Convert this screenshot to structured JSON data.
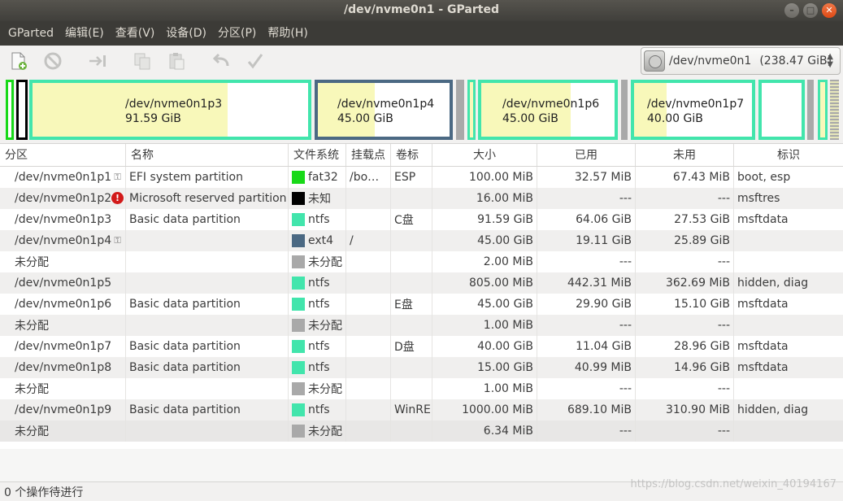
{
  "window": {
    "title": "/dev/nvme0n1 - GParted"
  },
  "menu": [
    "GParted",
    "编辑(E)",
    "查看(V)",
    "设备(D)",
    "分区(P)",
    "帮助(H)"
  ],
  "toolbar": {
    "icons": [
      "new-partition-icon",
      "delete-icon",
      "resize-move-icon",
      "copy-icon",
      "paste-icon",
      "undo-icon",
      "apply-icon"
    ]
  },
  "device_selector": {
    "device": "/dev/nvme0n1",
    "size": "(238.47 GiB)",
    "icon": "disk-icon"
  },
  "map": {
    "labels": [
      {
        "name": "/dev/nvme0n1p3",
        "size": "91.59 GiB"
      },
      {
        "name": "/dev/nvme0n1p4",
        "size": "45.00 GiB"
      },
      {
        "name": "/dev/nvme0n1p6",
        "size": "45.00 GiB"
      },
      {
        "name": "/dev/nvme0n1p7",
        "size": "40.00 GiB"
      }
    ]
  },
  "colors": {
    "ntfs": "#42e5ac",
    "fat32": "#18d918",
    "unknown": "#000000",
    "ext4": "#4b6983",
    "unallocated": "#a9a9a9",
    "used_fill": "#f8f8ba",
    "free_fill": "#ffffff"
  },
  "table": {
    "headers": [
      "分区",
      "名称",
      "文件系统",
      "挂载点",
      "卷标",
      "大小",
      "已用",
      "未用",
      "标识"
    ],
    "rows": [
      {
        "partition": "/dev/nvme0n1p1",
        "icon": "key-icon",
        "name": "EFI system partition",
        "fs": "fat32",
        "fs_color": "#18d918",
        "mount": "/bo…",
        "label": "ESP",
        "size": "100.00 MiB",
        "used": "32.57 MiB",
        "unused": "67.43 MiB",
        "flags": "boot, esp"
      },
      {
        "partition": "/dev/nvme0n1p2",
        "icon": "warning-icon",
        "name": "Microsoft reserved partition",
        "fs": "未知",
        "fs_color": "#000000",
        "mount": "",
        "label": "",
        "size": "16.00 MiB",
        "used": "---",
        "unused": "---",
        "flags": "msftres"
      },
      {
        "partition": "/dev/nvme0n1p3",
        "icon": "",
        "name": "Basic data partition",
        "fs": "ntfs",
        "fs_color": "#42e5ac",
        "mount": "",
        "label": "C盘",
        "size": "91.59 GiB",
        "used": "64.06 GiB",
        "unused": "27.53 GiB",
        "flags": "msftdata"
      },
      {
        "partition": "/dev/nvme0n1p4",
        "icon": "key-icon",
        "name": "",
        "fs": "ext4",
        "fs_color": "#4b6983",
        "mount": "/",
        "label": "",
        "size": "45.00 GiB",
        "used": "19.11 GiB",
        "unused": "25.89 GiB",
        "flags": ""
      },
      {
        "partition": "未分配",
        "icon": "",
        "name": "",
        "fs": "未分配",
        "fs_color": "#a9a9a9",
        "mount": "",
        "label": "",
        "size": "2.00 MiB",
        "used": "---",
        "unused": "---",
        "flags": ""
      },
      {
        "partition": "/dev/nvme0n1p5",
        "icon": "",
        "name": "",
        "fs": "ntfs",
        "fs_color": "#42e5ac",
        "mount": "",
        "label": "",
        "size": "805.00 MiB",
        "used": "442.31 MiB",
        "unused": "362.69 MiB",
        "flags": "hidden, diag"
      },
      {
        "partition": "/dev/nvme0n1p6",
        "icon": "",
        "name": "Basic data partition",
        "fs": "ntfs",
        "fs_color": "#42e5ac",
        "mount": "",
        "label": "E盘",
        "size": "45.00 GiB",
        "used": "29.90 GiB",
        "unused": "15.10 GiB",
        "flags": "msftdata"
      },
      {
        "partition": "未分配",
        "icon": "",
        "name": "",
        "fs": "未分配",
        "fs_color": "#a9a9a9",
        "mount": "",
        "label": "",
        "size": "1.00 MiB",
        "used": "---",
        "unused": "---",
        "flags": ""
      },
      {
        "partition": "/dev/nvme0n1p7",
        "icon": "",
        "name": "Basic data partition",
        "fs": "ntfs",
        "fs_color": "#42e5ac",
        "mount": "",
        "label": "D盘",
        "size": "40.00 GiB",
        "used": "11.04 GiB",
        "unused": "28.96 GiB",
        "flags": "msftdata"
      },
      {
        "partition": "/dev/nvme0n1p8",
        "icon": "",
        "name": "Basic data partition",
        "fs": "ntfs",
        "fs_color": "#42e5ac",
        "mount": "",
        "label": "",
        "size": "15.00 GiB",
        "used": "40.99 MiB",
        "unused": "14.96 GiB",
        "flags": "msftdata"
      },
      {
        "partition": "未分配",
        "icon": "",
        "name": "",
        "fs": "未分配",
        "fs_color": "#a9a9a9",
        "mount": "",
        "label": "",
        "size": "1.00 MiB",
        "used": "---",
        "unused": "---",
        "flags": ""
      },
      {
        "partition": "/dev/nvme0n1p9",
        "icon": "",
        "name": "Basic data partition",
        "fs": "ntfs",
        "fs_color": "#42e5ac",
        "mount": "",
        "label": "WinRE",
        "size": "1000.00 MiB",
        "used": "689.10 MiB",
        "unused": "310.90 MiB",
        "flags": "hidden, diag"
      },
      {
        "partition": "未分配",
        "icon": "",
        "name": "",
        "fs": "未分配",
        "fs_color": "#a9a9a9",
        "mount": "",
        "label": "",
        "size": "6.34 MiB",
        "used": "---",
        "unused": "---",
        "flags": ""
      }
    ]
  },
  "status": {
    "text": "0 个操作待进行"
  },
  "watermark": "https://blog.csdn.net/weixin_40194167"
}
